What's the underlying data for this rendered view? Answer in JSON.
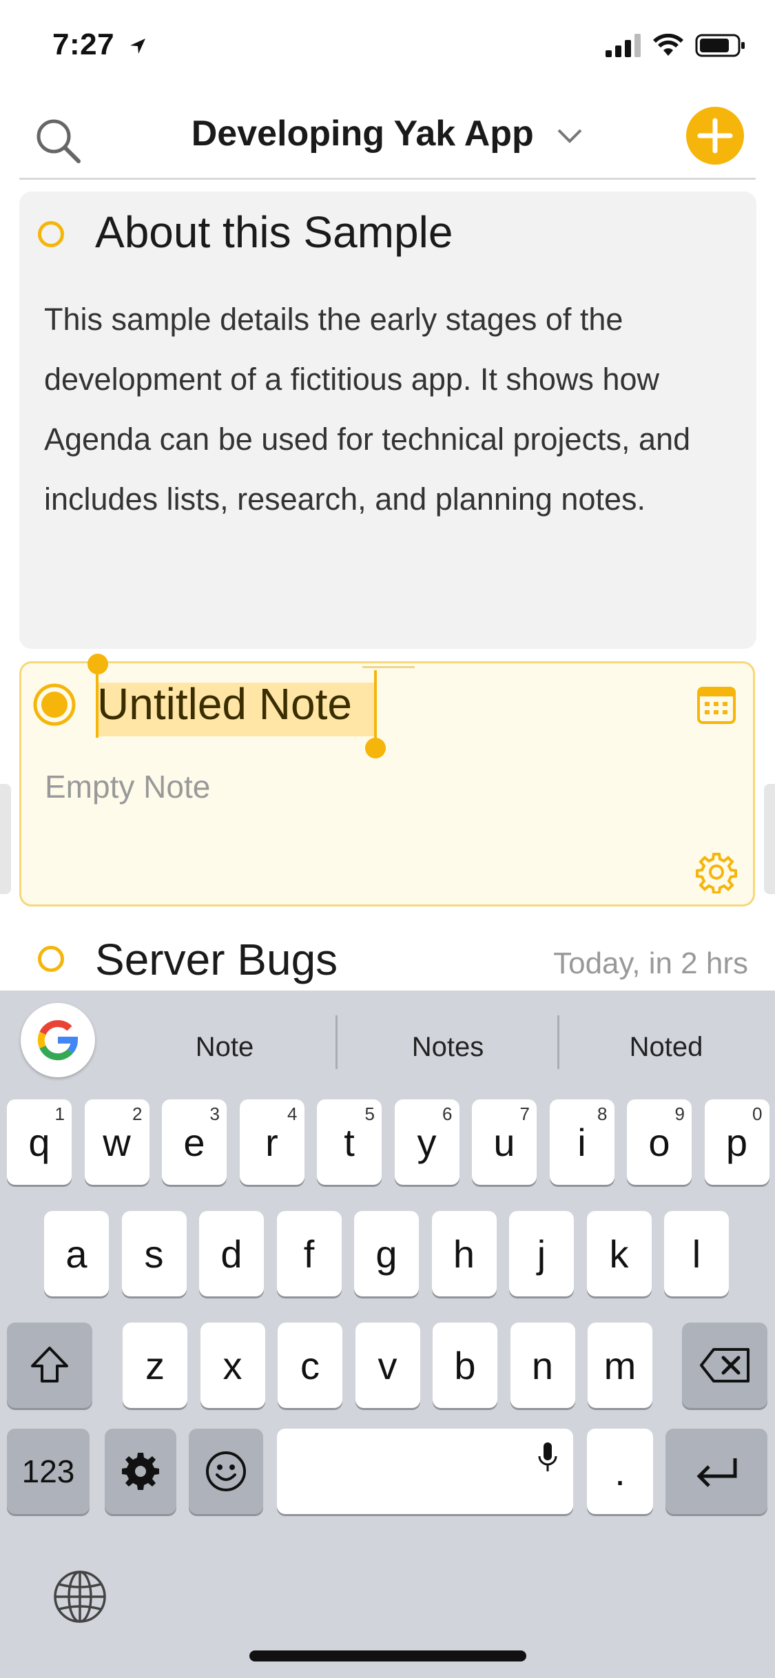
{
  "status_bar": {
    "time": "7:27"
  },
  "header": {
    "title": "Developing Yak App"
  },
  "notes": [
    {
      "title": "About this Sample",
      "body": "This sample details the early stages of the development of a fictitious app. It shows how Agenda can be used for technical projects, and includes lists, research, and planning notes."
    },
    {
      "title": "Untitled Note",
      "placeholder": "Empty Note"
    },
    {
      "title": "Server Bugs",
      "date": "Today, in 2 hrs"
    }
  ],
  "keyboard": {
    "suggestions": [
      "Note",
      "Notes",
      "Noted"
    ],
    "row1": [
      {
        "letter": "q",
        "num": "1"
      },
      {
        "letter": "w",
        "num": "2"
      },
      {
        "letter": "e",
        "num": "3"
      },
      {
        "letter": "r",
        "num": "4"
      },
      {
        "letter": "t",
        "num": "5"
      },
      {
        "letter": "y",
        "num": "6"
      },
      {
        "letter": "u",
        "num": "7"
      },
      {
        "letter": "i",
        "num": "8"
      },
      {
        "letter": "o",
        "num": "9"
      },
      {
        "letter": "p",
        "num": "0"
      }
    ],
    "row2": [
      "a",
      "s",
      "d",
      "f",
      "g",
      "h",
      "j",
      "k",
      "l"
    ],
    "row3": [
      "z",
      "x",
      "c",
      "v",
      "b",
      "n",
      "m"
    ],
    "numbers_key": "123",
    "period_key": "."
  },
  "colors": {
    "accent": "#f5b50a",
    "note_bg": "#f2f2f2",
    "selected_note_bg": "#fffbea",
    "keyboard_bg": "#d1d4da"
  }
}
